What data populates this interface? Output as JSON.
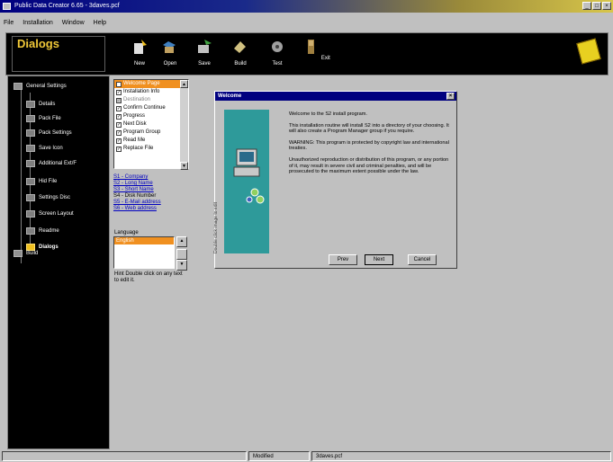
{
  "window": {
    "title": "Public Data Creator 6.65 - 3daves.pcf"
  },
  "menu": [
    "File",
    "Installation",
    "Window",
    "Help"
  ],
  "toolbar": {
    "section_title": "Dialogs",
    "buttons": [
      {
        "label": "New",
        "icon": "new-icon"
      },
      {
        "label": "Open",
        "icon": "open-icon"
      },
      {
        "label": "Save",
        "icon": "save-icon"
      },
      {
        "label": "Build",
        "icon": "build-icon"
      },
      {
        "label": "Test",
        "icon": "test-icon"
      },
      {
        "label": "Exit",
        "icon": "exit-icon"
      }
    ]
  },
  "tree": {
    "root": "General Settings",
    "items": [
      "Details",
      "Pack File",
      "Pack Settings",
      "Save Icon",
      "Additional Ext/F",
      "Hid File",
      "Settings Disc",
      "Screen Layout",
      "Readme",
      "Dialogs"
    ],
    "selected": "Dialogs",
    "bottom": "Build"
  },
  "dialog_list": [
    {
      "label": "Welcome Page",
      "checked": true,
      "selected": true
    },
    {
      "label": "Installation Info",
      "checked": true
    },
    {
      "label": "Destination",
      "checked": true,
      "dim": true
    },
    {
      "label": "Confirm Continue",
      "checked": true
    },
    {
      "label": "Progress",
      "checked": true
    },
    {
      "label": "Next Disk",
      "checked": true
    },
    {
      "label": "Program Group",
      "checked": true
    },
    {
      "label": "Read Me",
      "checked": true
    },
    {
      "label": "Replace File",
      "checked": true
    }
  ],
  "fields": [
    {
      "text": "S1 - Company",
      "link": true
    },
    {
      "text": "S2 - Long Name",
      "link": true
    },
    {
      "text": "S3 - Short Name",
      "link": true
    },
    {
      "text": "S4 - Disk Number",
      "link": false
    },
    {
      "text": "S5 - E-Mail address",
      "link": true
    },
    {
      "text": "S6 - Web address",
      "link": true
    }
  ],
  "language": {
    "label": "Language",
    "selected": "English"
  },
  "hint": "Hint Double click on any text to edit it.",
  "preview": {
    "title": "Welcome",
    "side_text": "Double click image to edit",
    "paragraphs": [
      "Welcome to the S2 install program.",
      "This installation routine will install S2 into a directory of your choosing. It will also create a Program Manager group if you require.",
      "WARNING: This program is protected by copyright law and international treaties.",
      "Unauthorized reproduction or distribution of this program, or any portion of it, may result in severe civil and criminal penalties, and will be prosecuted to the maximum extent possible under the law."
    ],
    "buttons": {
      "prev": "Prev",
      "next": "Next",
      "cancel": "Cancel"
    }
  },
  "status": {
    "state": "Modified",
    "file": "3daves.pcf"
  },
  "colors": {
    "selection": "#f09020",
    "accent_title": "#f0c838",
    "teal": "#2e9a9a"
  }
}
